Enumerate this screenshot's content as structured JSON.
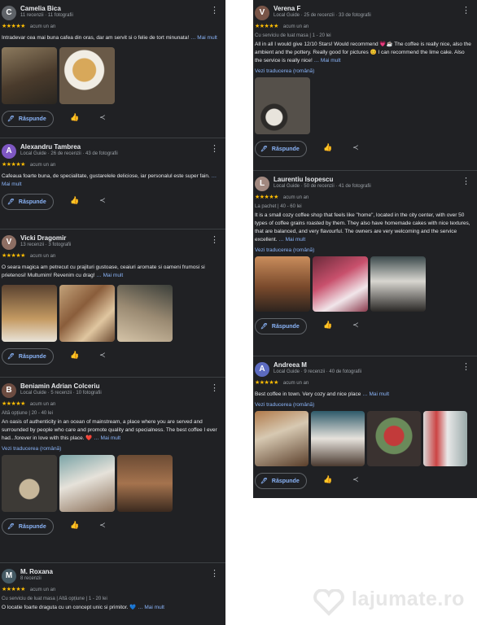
{
  "ui": {
    "reply_label": "Răspunde",
    "translate_label": "Vezi traducerea (română)",
    "more_label": "Mai mult",
    "star_glyphs": "★★★★★",
    "menu_glyph": "⋮",
    "like_glyph": "👍",
    "share_glyph": "≺",
    "reply_glyph": "🖊"
  },
  "left_reviews": [
    {
      "initial": "C",
      "avatar_color": "#5f6368",
      "name": "Camelia Bica",
      "meta": "11 recenzii · 11 fotografii",
      "ago": "acum un an",
      "extra": "",
      "text": "Intradevar cea mai buna cafea din oras, dar am servit si o felie de tort minunata!",
      "more": "… Mai mult",
      "photos": 2
    },
    {
      "initial": "A",
      "avatar_color": "#7e57c2",
      "name": "Alexandru Tambrea",
      "meta": "Local Guide · 26 de recenzii · 43 de fotografii",
      "ago": "acum un an",
      "extra": "",
      "text": "Cafeaua foarte buna, de specialitate, gustarelele deliciose, iar personalul este super fain.",
      "more": "… Mai mult",
      "photos": 0
    },
    {
      "initial": "V",
      "avatar_color": "#8d6e63",
      "name": "Vicki Dragomir",
      "meta": "13 recenzii · 3 fotografii",
      "ago": "acum un an",
      "extra": "",
      "text": "O seara magica am petrecut cu prajituri gustoase, ceaiuri aromate si oameni frumosi si prietenosi! Multumim! Revenim cu drag!",
      "more": "… Mai mult",
      "photos": 3
    },
    {
      "initial": "B",
      "avatar_color": "#6d4c41",
      "name": "Beniamin Adrian Colceriu",
      "meta": "Local Guide · 5 recenzii · 10 fotografii",
      "ago": "acum un an",
      "extra": "Altă opțiune | 20 - 40 lei",
      "text": "An oasis of authenticity in an ocean of mainstream, a place where you are served and surrounded by people who care and promote quality and specialness. The best coffee I ever had...forever in love with this place. ❤️",
      "more": "… Mai mult",
      "translate": true,
      "photos": 3
    },
    {
      "initial": "M",
      "avatar_color": "#455a64",
      "name": "M. Roxana",
      "meta": "8 recenzii",
      "ago": "acum un an",
      "extra": "Cu serviciu de luat masa | Altă opțiune | 1 - 20 lei",
      "text": "O locatie foarte draguta cu un concept unic si primitor. 💙",
      "more": "… Mai mult",
      "photos": 0
    }
  ],
  "right_reviews": [
    {
      "initial": "V",
      "avatar_color": "#795548",
      "name": "Verena F",
      "meta": "Local Guide · 25 de recenzii · 33 de fotografii",
      "ago": "acum un an",
      "extra": "Cu serviciu de luat masa | 1 - 20 lei",
      "text": "All in all I would give 12/10 Stars! Would recommend 💗☕ The coffee is really nice, also the ambient and the pottery. Really good for pictures 😊 I can recommend the lime cake. Also the service is really nice!",
      "more": "… Mai mult",
      "translate": true,
      "photos": 1
    },
    {
      "initial": "L",
      "avatar_color": "#a1887f",
      "name": "Laurentiu Isopescu",
      "meta": "Local Guide · 50 de recenzii · 41 de fotografii",
      "ago": "acum un an",
      "extra": "La pachet | 40 - 60 lei",
      "text": "It is a small cozy coffee shop that feels like \"home\", located in the city center, with over 50 types of coffee grains roasted by them. They also have homemade cakes with nice textures, that are balanced, and very flavourful. The owners are very welcoming and the service excellent.",
      "more": "… Mai mult",
      "translate": true,
      "photos": 3
    },
    {
      "initial": "A",
      "avatar_color": "#5c6bc0",
      "name": "Andreea M",
      "meta": "Local Guide · 9 recenzii · 40 de fotografii",
      "ago": "acum un an",
      "extra": "",
      "text": "Best coffee in town. Very cozy and nice place",
      "more": "… Mai mult",
      "translate": true,
      "photos": 4
    }
  ],
  "watermark": "lajumate.ro",
  "colors": {
    "panel_bg": "#202124",
    "star": "#fbbc04",
    "link": "#8ab4f8",
    "muted": "#9aa0a6"
  }
}
